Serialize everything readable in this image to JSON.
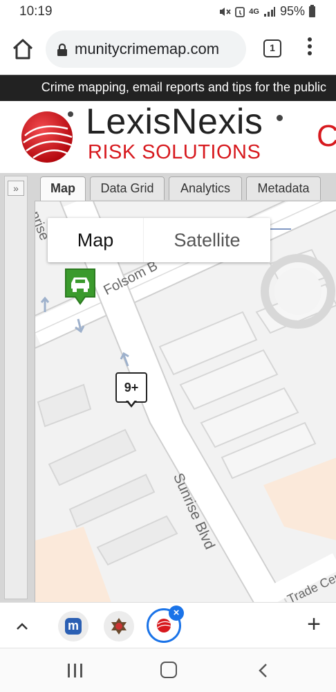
{
  "status_bar": {
    "time": "10:19",
    "battery": "95%",
    "network": "4G"
  },
  "browser": {
    "url": "munitycrimemap.com",
    "tab_count": "1"
  },
  "site": {
    "tagline": "Crime mapping, email reports and tips for the public",
    "logo_name": "LexisNexis",
    "logo_sub": "RISK SOLUTIONS",
    "logo_cut": "C",
    "brand_red": "#d7191e"
  },
  "app": {
    "expand_label": "»",
    "tabs": [
      {
        "label": "Map",
        "active": true
      },
      {
        "label": "Data Grid",
        "active": false
      },
      {
        "label": "Analytics",
        "active": false
      },
      {
        "label": "Metadata",
        "active": false
      }
    ]
  },
  "map": {
    "toggle": {
      "map": "Map",
      "satellite": "Satellite",
      "selected": "Map"
    },
    "roads": {
      "folsom": "Folsom B",
      "sunrise": "Sunrise Blvd",
      "sunrise_top": "nrise",
      "trade": "Trade Cen"
    },
    "cluster_count": "9+",
    "car_marker_icon": "car-icon",
    "car_marker_color": "#3a9a2c"
  },
  "bottom_bar": {
    "plus": "+",
    "fav_m": "m",
    "close": "×"
  }
}
